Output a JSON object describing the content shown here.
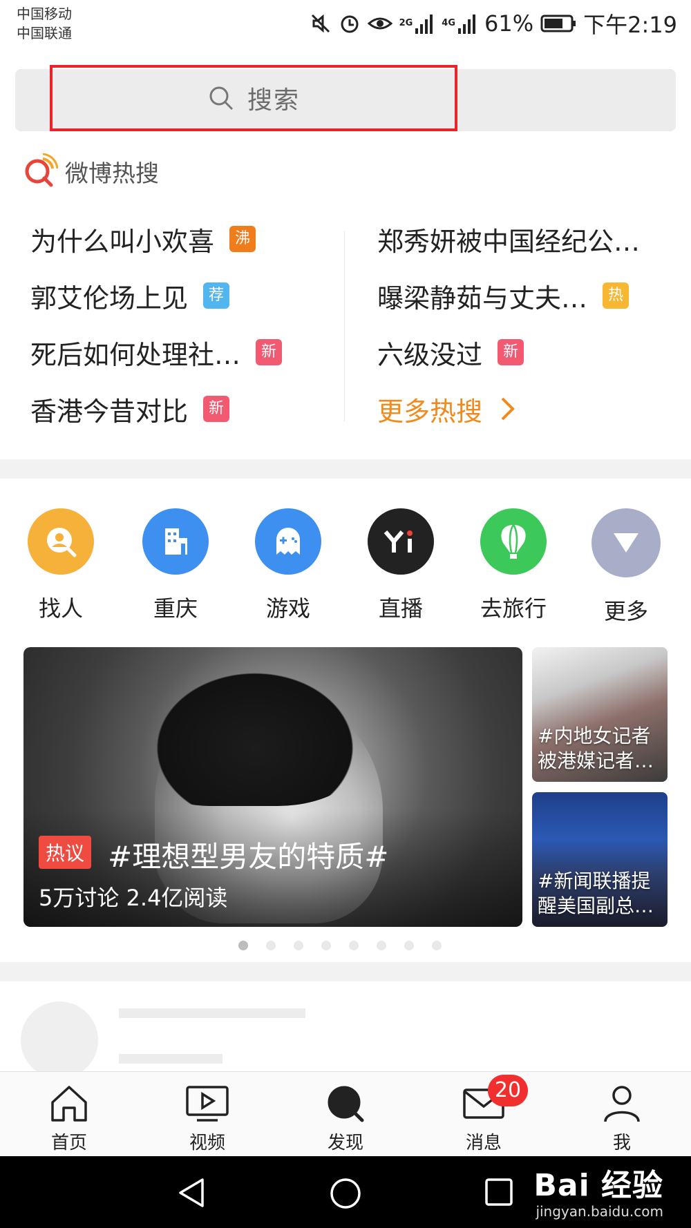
{
  "status_bar": {
    "carrier1": "中国移动",
    "carrier2": "中国联通",
    "signal_a": "2G",
    "signal_b": "4G",
    "battery": "61%",
    "time": "下午2:19"
  },
  "search": {
    "placeholder": "搜索"
  },
  "hot_search": {
    "title": "微博热搜",
    "left": [
      {
        "text": "为什么叫小欢喜",
        "badge": "沸",
        "badge_type": "boil"
      },
      {
        "text": "郭艾伦场上见",
        "badge": "荐",
        "badge_type": "rec"
      },
      {
        "text": "死后如何处理社…",
        "badge": "新",
        "badge_type": "new"
      },
      {
        "text": "香港今昔对比",
        "badge": "新",
        "badge_type": "new"
      }
    ],
    "right": [
      {
        "text": "郑秀妍被中国经纪公…",
        "badge": "",
        "badge_type": ""
      },
      {
        "text": "曝梁静茹与丈夫…",
        "badge": "热",
        "badge_type": "hot"
      },
      {
        "text": "六级没过",
        "badge": "新",
        "badge_type": "new"
      }
    ],
    "more": "更多热搜"
  },
  "quick_links": [
    {
      "label": "找人",
      "icon": "person-search-icon",
      "color": "#f6b13a"
    },
    {
      "label": "重庆",
      "icon": "building-icon",
      "color": "#3d8ff0"
    },
    {
      "label": "游戏",
      "icon": "game-ghost-icon",
      "color": "#3d8ff0"
    },
    {
      "label": "直播",
      "icon": "yi-live-icon",
      "color": "#222222"
    },
    {
      "label": "去旅行",
      "icon": "balloon-icon",
      "color": "#3cc95a"
    },
    {
      "label": "更多",
      "icon": "triangle-down-icon",
      "color": "#a9aec8"
    }
  ],
  "banner": {
    "tag": "热议",
    "title": "#理想型男友的特质#",
    "stats": "5万讨论  2.4亿阅读",
    "side1_line1": "#内地女记者",
    "side1_line2": "被港媒记者…",
    "side2_line1": "#新闻联播提",
    "side2_line2": "醒美国副总…"
  },
  "tabbar": {
    "home": "首页",
    "video": "视频",
    "discover": "发现",
    "messages": "消息",
    "messages_badge": "20",
    "me": "我"
  },
  "watermark": {
    "main": "Bai 经验",
    "sub": "jingyan.baidu.com"
  }
}
